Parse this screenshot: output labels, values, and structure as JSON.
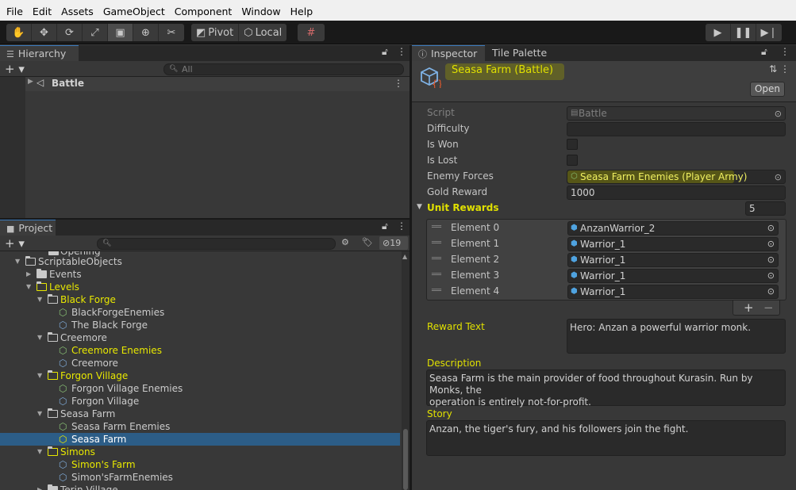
{
  "menu": [
    "File",
    "Edit",
    "Assets",
    "GameObject",
    "Component",
    "Window",
    "Help"
  ],
  "toolbar": {
    "pivot_label": "Pivot",
    "local_label": "Local"
  },
  "hierarchy": {
    "tab_label": "Hierarchy",
    "search_placeholder": "All",
    "scene_name": "Battle"
  },
  "project": {
    "tab_label": "Project",
    "hidden_count": "19",
    "rows": [
      {
        "text": "Opening"
      },
      {
        "text": "ScriptableObjects"
      },
      {
        "text": "Events"
      },
      {
        "text": "Levels"
      },
      {
        "text": "Black Forge"
      },
      {
        "text": "BlackForgeEnemies"
      },
      {
        "text": "The Black Forge"
      },
      {
        "text": "Creemore"
      },
      {
        "text": "Creemore Enemies"
      },
      {
        "text": "Creemore"
      },
      {
        "text": "Forgon Village"
      },
      {
        "text": "Forgon Village Enemies"
      },
      {
        "text": "Forgon Village"
      },
      {
        "text": "Seasa Farm"
      },
      {
        "text": "Seasa Farm Enemies"
      },
      {
        "text": "Seasa Farm"
      },
      {
        "text": "Simons"
      },
      {
        "text": "Simon's Farm"
      },
      {
        "text": "Simon'sFarmEnemies"
      },
      {
        "text": "Terin Village"
      }
    ]
  },
  "inspector": {
    "tab_label": "Inspector",
    "tab2_label": "Tile Palette",
    "title": "Seasa Farm (Battle)",
    "open_label": "Open",
    "fields": {
      "script_label": "Script",
      "script_value": "Battle",
      "difficulty_label": "Difficulty",
      "is_won_label": "Is Won",
      "is_lost_label": "Is Lost",
      "enemy_forces_label": "Enemy Forces",
      "enemy_forces_value": "Seasa Farm Enemies (Player Army)",
      "gold_reward_label": "Gold Reward",
      "gold_reward_value": "1000",
      "unit_rewards_label": "Unit Rewards",
      "unit_rewards_count": "5"
    },
    "unit_rewards": [
      {
        "label": "Element 0",
        "value": "AnzanWarrior_2"
      },
      {
        "label": "Element 1",
        "value": "Warrior_1"
      },
      {
        "label": "Element 2",
        "value": "Warrior_1"
      },
      {
        "label": "Element 3",
        "value": "Warrior_1"
      },
      {
        "label": "Element 4",
        "value": "Warrior_1"
      }
    ],
    "reward_text_label": "Reward Text",
    "reward_text": "Hero: Anzan a powerful warrior monk.",
    "description_label": "Description",
    "description_line1": "Seasa Farm is the main provider of food throughout Kurasin. Run by Monks, the",
    "description_line2": "operation is entirely not-for-profit.",
    "story_label": "Story",
    "story": "Anzan, the tiger's fury, and his followers join the fight."
  },
  "colors": {
    "highlight": "#e8e800",
    "selection": "#2c5d87",
    "background": "#383838"
  }
}
